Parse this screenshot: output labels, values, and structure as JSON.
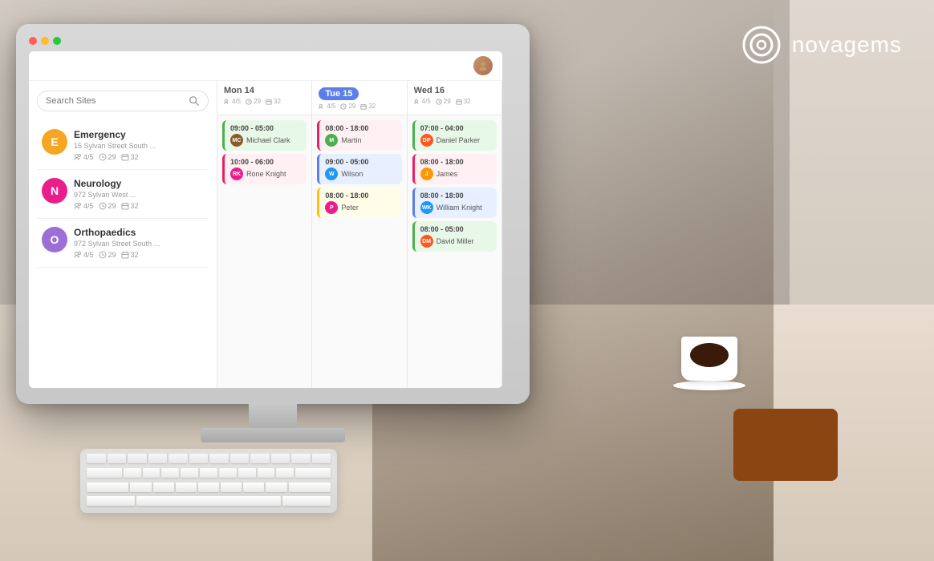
{
  "background": {
    "desk_color": "#d4c8b8",
    "wall_color": "#c8bfb5"
  },
  "logo": {
    "text": "novagems",
    "icon": "circle-logo"
  },
  "monitor": {
    "buttons": [
      "red",
      "yellow",
      "green"
    ]
  },
  "app": {
    "header": {
      "user_avatar_label": "User"
    },
    "search": {
      "placeholder": "Search Sites"
    },
    "sites": [
      {
        "id": "emergency",
        "name": "Emergency",
        "address": "15 Sylvan Street South ...",
        "avatar_letter": "E",
        "avatar_color": "#f5a623",
        "stats": {
          "people": "4/5",
          "clock": "29",
          "calendar": "32"
        }
      },
      {
        "id": "neurology",
        "name": "Neurology",
        "address": "972 Sylvan West ...",
        "avatar_letter": "N",
        "avatar_color": "#e91e8c",
        "stats": {
          "people": "4/5",
          "clock": "29",
          "calendar": "32"
        }
      },
      {
        "id": "orthopaedics",
        "name": "Orthopaedics",
        "address": "972 Sylvan Street South ...",
        "avatar_letter": "O",
        "avatar_color": "#9c6fd6",
        "stats": {
          "people": "4/5",
          "clock": "29",
          "calendar": "32"
        }
      }
    ],
    "days": [
      {
        "label": "Mon 14",
        "active": false,
        "stats": {
          "people": "4/5",
          "clock": "29",
          "calendar": "32"
        },
        "shifts": [
          {
            "time": "09:00 - 05:00",
            "person": "Michael Clark",
            "color": "green",
            "avatar_color": "#8B5A2B",
            "avatar_letter": "MC"
          },
          {
            "time": "10:00 - 06:00",
            "person": "Rone Knight",
            "color": "pink",
            "avatar_color": "#e91e8c",
            "avatar_letter": "RK"
          }
        ]
      },
      {
        "label": "Tue 15",
        "active": true,
        "stats": {
          "people": "4/5",
          "clock": "29",
          "calendar": "32"
        },
        "shifts": [
          {
            "time": "08:00 - 18:00",
            "person": "Martin",
            "color": "pink",
            "avatar_color": "#4caf50",
            "avatar_letter": "M"
          },
          {
            "time": "09:00 - 05:00",
            "person": "Wilson",
            "color": "blue",
            "avatar_color": "#2196f3",
            "avatar_letter": "W"
          },
          {
            "time": "08:00 - 18:00",
            "person": "Peter",
            "color": "yellow",
            "avatar_color": "#e91e8c",
            "avatar_letter": "P"
          }
        ]
      },
      {
        "label": "Wed 16",
        "active": false,
        "stats": {
          "people": "4/5",
          "clock": "29",
          "calendar": "32"
        },
        "shifts": [
          {
            "time": "07:00 - 04:00",
            "person": "Daniel Parker",
            "color": "green",
            "avatar_color": "#ff5722",
            "avatar_letter": "DP"
          },
          {
            "time": "08:00 - 18:00",
            "person": "James",
            "color": "pink",
            "avatar_color": "#ff9800",
            "avatar_letter": "J"
          },
          {
            "time": "08:00 - 18:00",
            "person": "William Knight",
            "color": "blue",
            "avatar_color": "#2196f3",
            "avatar_letter": "WK"
          },
          {
            "time": "08:00 - 05:00",
            "person": "David Miller",
            "color": "green",
            "avatar_color": "#ff5722",
            "avatar_letter": "DM"
          }
        ]
      }
    ]
  }
}
